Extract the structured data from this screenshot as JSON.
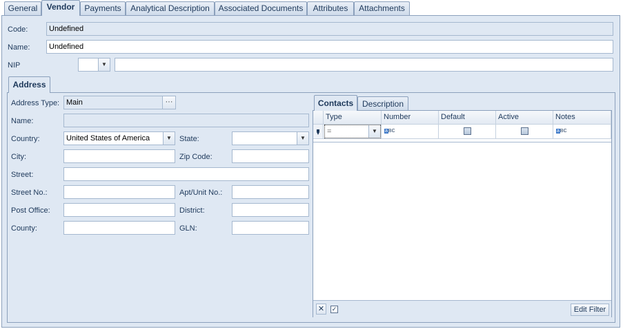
{
  "tabs": [
    "General",
    "Vendor",
    "Payments",
    "Analytical Description",
    "Associated Documents",
    "Attributes",
    "Attachments"
  ],
  "active_tab": "Vendor",
  "form": {
    "code_label": "Code:",
    "code_value": "Undefined",
    "name_label": "Name:",
    "name_value": "Undefined",
    "nip_label": "NIP",
    "nip_prefix": "",
    "nip_value": ""
  },
  "address": {
    "tab_label": "Address",
    "type_label": "Address Type:",
    "type_value": "Main",
    "type_button": "···",
    "name_label": "Name:",
    "name_value": "",
    "country_label": "Country:",
    "country_value": "United States of America",
    "state_label": "State:",
    "state_value": "",
    "city_label": "City:",
    "city_value": "",
    "zip_label": "Zip Code:",
    "zip_value": "",
    "street_label": "Street:",
    "street_value": "",
    "street_no_label": "Street No.:",
    "street_no_value": "",
    "apt_label": "Apt/Unit No.:",
    "apt_value": "",
    "post_office_label": "Post Office:",
    "post_office_value": "",
    "district_label": "District:",
    "district_value": "",
    "county_label": "County:",
    "county_value": "",
    "gln_label": "GLN:",
    "gln_value": ""
  },
  "contacts": {
    "tabs": [
      "Contacts",
      "Description"
    ],
    "active_tab": "Contacts",
    "columns": [
      "Type",
      "Number",
      "Default",
      "Active",
      "Notes"
    ],
    "new_row_type": "=",
    "edit_filter_label": "Edit Filter"
  },
  "icons": {
    "dropdown": "chevron-down-icon",
    "new_row": "pencil-icon",
    "text_field": "abc-icon",
    "filter_close": "close-icon",
    "filter_enable": "checkmark-icon"
  },
  "colors": {
    "panel_bg": "#dfe8f3",
    "border": "#8ba0bc",
    "text": "#1e395b"
  }
}
